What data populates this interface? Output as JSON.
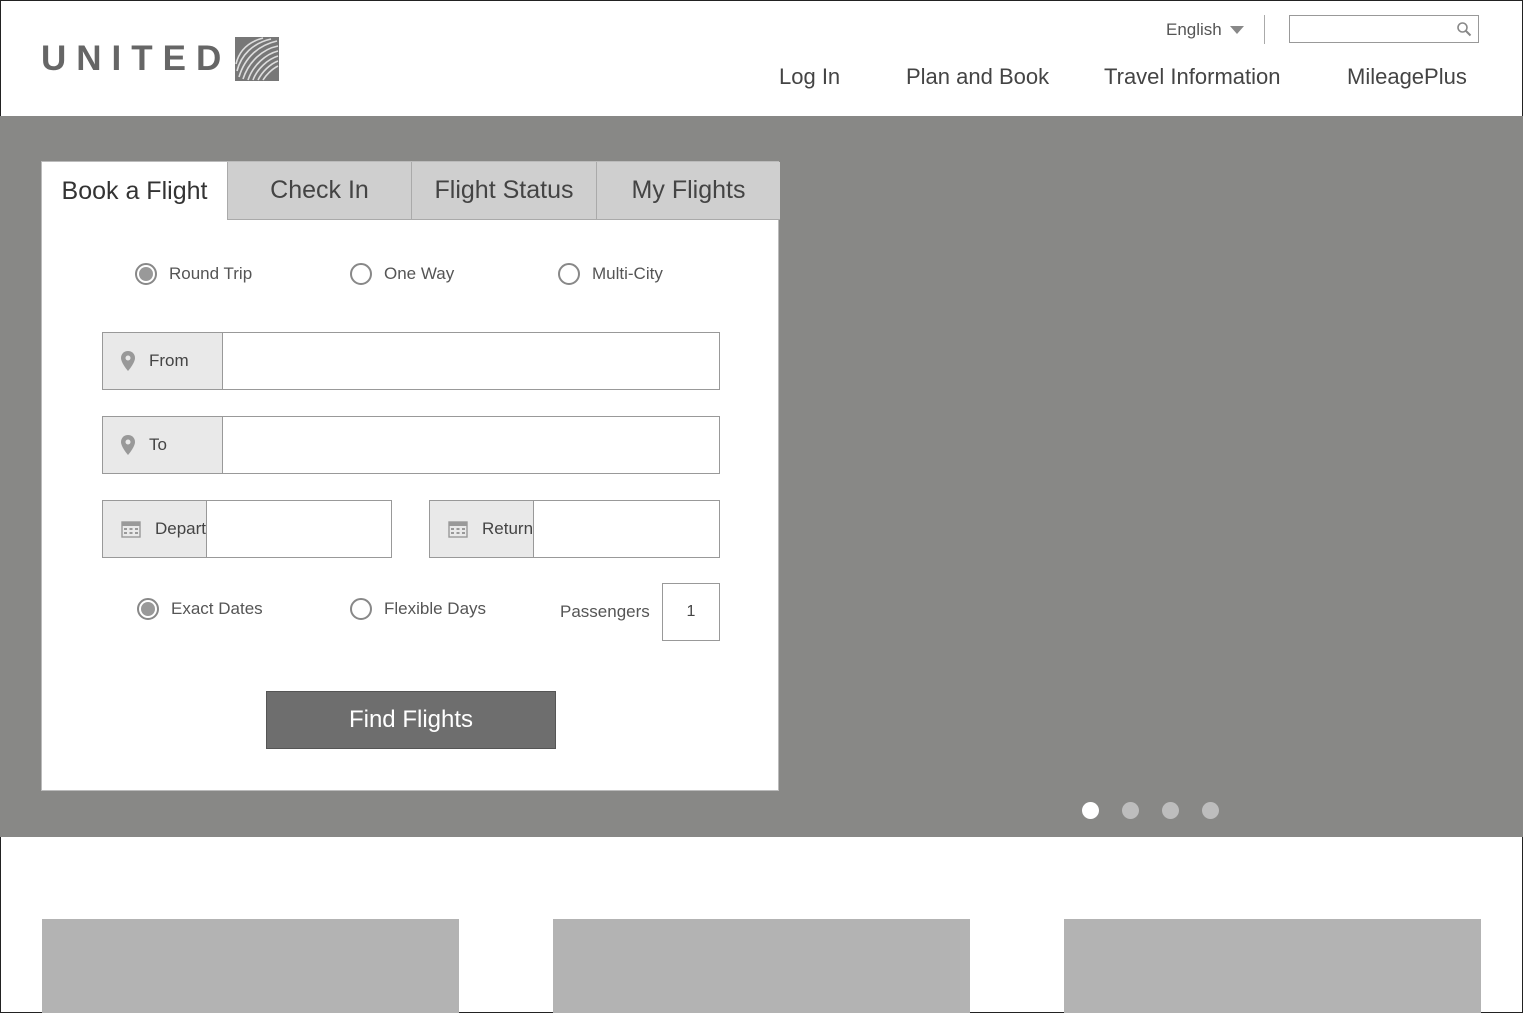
{
  "header": {
    "logo_text": "UNITED",
    "language": "English",
    "search_placeholder": "",
    "nav": [
      "Log In",
      "Plan and Book",
      "Travel Information",
      "MileagePlus"
    ]
  },
  "booking": {
    "tabs": [
      "Book a Flight",
      "Check In",
      "Flight Status",
      "My Flights"
    ],
    "active_tab": "Book a Flight",
    "trip_types": [
      "Round Trip",
      "One Way",
      "Multi-City"
    ],
    "selected_trip_type": "Round Trip",
    "from_label": "From",
    "to_label": "To",
    "depart_label": "Depart",
    "return_label": "Return",
    "date_options": [
      "Exact Dates",
      "Flexible Days"
    ],
    "selected_date_option": "Exact Dates",
    "passengers_label": "Passengers",
    "passengers_value": "1",
    "find_button": "Find Flights"
  },
  "carousel": {
    "slides": 4,
    "active": 1
  },
  "colors": {
    "hero_bg": "#888886",
    "button_bg": "#6e6e6e",
    "card_bg": "#b3b3b3"
  }
}
